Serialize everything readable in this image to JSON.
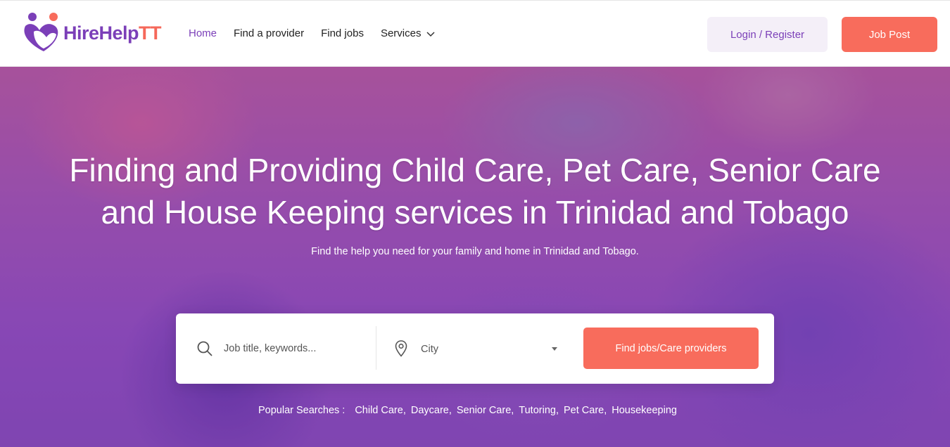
{
  "brand": {
    "name_main": "HireHelp",
    "name_accent": "TT"
  },
  "colors": {
    "purple": "#7b3fb8",
    "coral": "#f86c5c",
    "login_bg": "#f4eff8"
  },
  "nav": {
    "items": [
      {
        "label": "Home",
        "active": true
      },
      {
        "label": "Find a provider"
      },
      {
        "label": "Find jobs"
      },
      {
        "label": "Services",
        "icon": "chevron-down-icon"
      }
    ]
  },
  "header": {
    "login_label": "Login / Register",
    "job_post_label": "Job Post"
  },
  "hero": {
    "title_line1": "Finding and Providing Child Care, Pet Care, Senior Care",
    "title_line2": "and House Keeping services in Trinidad and Tobago",
    "subtitle": "Find the help you need for your family and home in Trinidad and Tobago."
  },
  "search": {
    "keyword_placeholder": "Job title, keywords...",
    "city_value": "City",
    "submit_label": "Find jobs/Care providers"
  },
  "popular": {
    "label": "Popular Searches :",
    "items": [
      "Child Care,",
      "Daycare,",
      "Senior Care,",
      "Tutoring,",
      "Pet Care,",
      "Housekeeping"
    ]
  }
}
